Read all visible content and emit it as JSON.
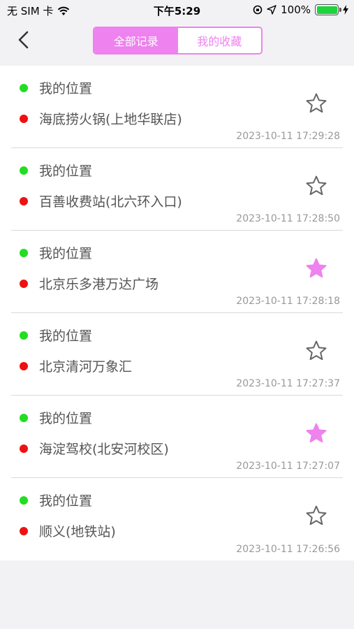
{
  "status_bar": {
    "carrier": "无 SIM 卡",
    "time": "下午5:29",
    "battery": "100%"
  },
  "nav": {
    "tabs": [
      {
        "label": "全部记录",
        "active": true
      },
      {
        "label": "我的收藏",
        "active": false
      }
    ]
  },
  "colors": {
    "accent": "#ee82ee",
    "start_dot": "#22dd22",
    "end_dot": "#ee1111"
  },
  "records": [
    {
      "from": "我的位置",
      "to": "海底捞火锅(上地华联店)",
      "time": "2023-10-11 17:29:28",
      "favorited": false
    },
    {
      "from": "我的位置",
      "to": "百善收费站(北六环入口)",
      "time": "2023-10-11 17:28:50",
      "favorited": false
    },
    {
      "from": "我的位置",
      "to": "北京乐多港万达广场",
      "time": "2023-10-11 17:28:18",
      "favorited": true
    },
    {
      "from": "我的位置",
      "to": "北京清河万象汇",
      "time": "2023-10-11 17:27:37",
      "favorited": false
    },
    {
      "from": "我的位置",
      "to": "海淀驾校(北安河校区)",
      "time": "2023-10-11 17:27:07",
      "favorited": true
    },
    {
      "from": "我的位置",
      "to": "顺义(地铁站)",
      "time": "2023-10-11 17:26:56",
      "favorited": false
    }
  ]
}
